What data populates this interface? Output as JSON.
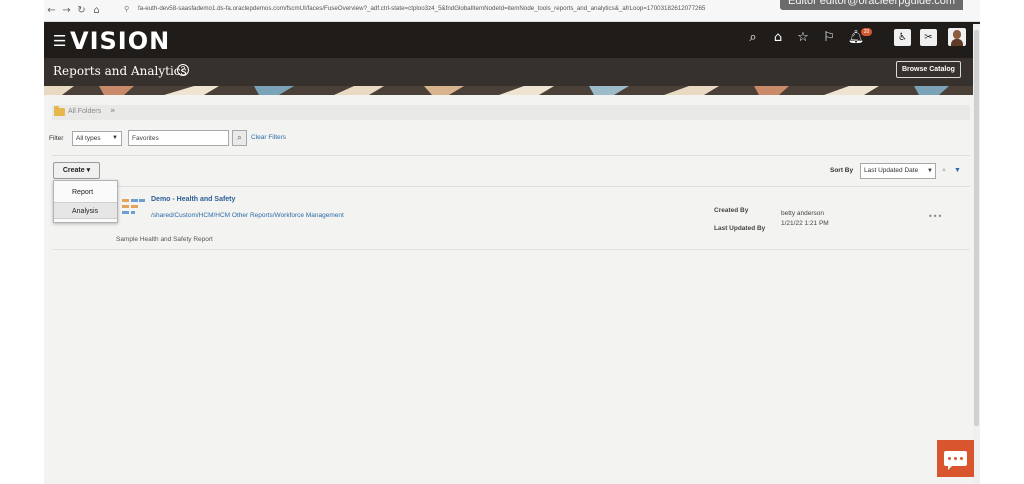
{
  "browser": {
    "url": "fa-euth-dev58-saasfademo1.ds-fa.oraclepdemos.com/fscmUI/faces/FuseOverview?_adf.ctrl-state=ctploo3z4_5&fndGlobalItemNodeId=itemNode_tools_reports_and_analytics&_afrLoop=17003182612077265",
    "editor_tab": "Editor editor@oracleerpguide.com"
  },
  "header": {
    "brand": "VISION",
    "notification_count": "20"
  },
  "page": {
    "title": "Reports and Analytics",
    "browse_catalog": "Browse Catalog"
  },
  "breadcrumb": {
    "root": "All Folders"
  },
  "filter": {
    "label": "Filter",
    "type_value": "All types",
    "search_value": "Favorites",
    "clear_label": "Clear Filters"
  },
  "toolbar": {
    "create_label": "Create",
    "create_menu": [
      "Report",
      "Analysis"
    ],
    "sort_label": "Sort By",
    "sort_value": "Last Updated Date"
  },
  "items": [
    {
      "title": "Demo - Health and Safety",
      "path": "/shared/Custom/HCM/HCM Other Reports/Workforce Management",
      "description": "Sample Health and Safety Report",
      "created_by_label": "Created By",
      "created_by": "betty anderson",
      "last_updated_label": "Last Updated By",
      "last_updated": "1/21/22 1:21 PM"
    }
  ],
  "colors": {
    "header_bg": "#1f1c1a",
    "title_band_bg": "#37312e",
    "link": "#2d6ca8",
    "accent": "#d9552d"
  }
}
